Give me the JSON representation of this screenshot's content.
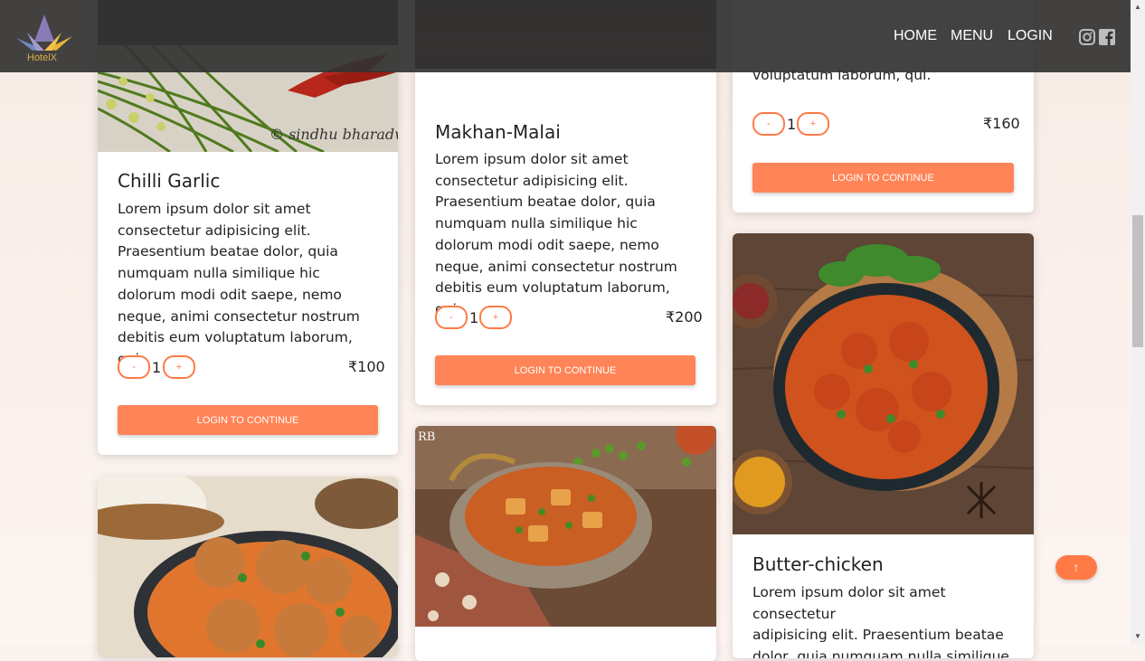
{
  "brand": {
    "name": "HotelX"
  },
  "nav": {
    "home": "HOME",
    "menu": "MENU",
    "login": "LOGIN"
  },
  "social": {
    "instagram": "instagram-icon",
    "facebook": "facebook-icon"
  },
  "description": "Lorem ipsum dolor sit amet consectetur adipisicing elit. Praesentium beatae dolor, quia numquam nulla similique hic dolorum modi odit saepe, nemo neque, animi consectetur nostrum debitis eum voluptatum laborum, qui.",
  "cards": {
    "chilli": {
      "title": "Chilli Garlic",
      "qty": "1",
      "price": "₹100",
      "minus": "-",
      "plus": "+",
      "button": "LOGIN TO CONTINUE",
      "img_caption": "© sindhu bharadwaj"
    },
    "makhan": {
      "title": "Makhan-Malai",
      "qty": "1",
      "price": "₹200",
      "minus": "-",
      "plus": "+",
      "button": "LOGIN TO CONTINUE"
    },
    "top_right": {
      "desc_tail": "voluptatum laborum, qui.",
      "qty": "1",
      "price": "₹160",
      "minus": "-",
      "plus": "+",
      "button": "LOGIN TO CONTINUE"
    },
    "butter": {
      "title": "Butter-chicken",
      "desc_lines": [
        "Lorem ipsum dolor sit amet consectetur",
        "adipisicing elit. Praesentium beatae",
        "dolor, quia numquam nulla similique hic"
      ]
    },
    "paneer": {
      "img_mark": "RB"
    }
  },
  "scroll_top": "↑",
  "colors": {
    "accent": "#ff7a45",
    "navbar": "#323232",
    "button": "#ff8457"
  }
}
